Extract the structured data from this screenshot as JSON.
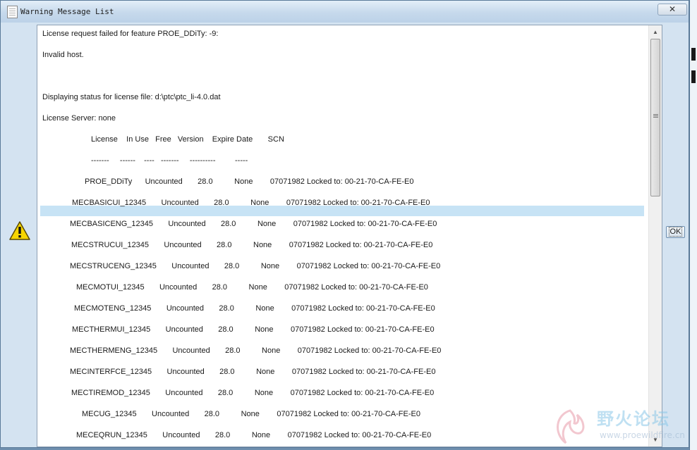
{
  "window": {
    "title": "Warning Message List",
    "close_label": "✕"
  },
  "messages": {
    "lines": [
      "License request failed for feature PROE_DDiTy: -9:",
      "Invalid host.",
      "Displaying status for license file: d:\\ptc\\ptc_li-4.0.dat",
      "License Server: none",
      "License    In Use   Free   Version    Expire Date       SCN",
      "-------     ------    ----   -------     ----------         -----"
    ],
    "rows": [
      {
        "text": "PROE_DDiTy      Uncounted       28.0          None        07071982 Locked to: 00-21-70-CA-FE-E0"
      },
      {
        "text": "MECBASICUI_12345       Uncounted       28.0          None        07071982 Locked to: 00-21-70-CA-FE-E0"
      },
      {
        "text": "MECBASICENG_12345       Uncounted       28.0          None        07071982 Locked to: 00-21-70-CA-FE-E0"
      },
      {
        "text": "MECSTRUCUI_12345       Uncounted       28.0          None        07071982 Locked to: 00-21-70-CA-FE-E0"
      },
      {
        "text": "MECSTRUCENG_12345       Uncounted       28.0          None        07071982 Locked to: 00-21-70-CA-FE-E0"
      },
      {
        "text": "MECMOTUI_12345       Uncounted       28.0          None        07071982 Locked to: 00-21-70-CA-FE-E0"
      },
      {
        "text": "MECMOTENG_12345       Uncounted       28.0          None        07071982 Locked to: 00-21-70-CA-FE-E0"
      },
      {
        "text": "MECTHERMUI_12345       Uncounted       28.0          None        07071982 Locked to: 00-21-70-CA-FE-E0"
      },
      {
        "text": "MECTHERMENG_12345       Uncounted       28.0          None        07071982 Locked to: 00-21-70-CA-FE-E0"
      },
      {
        "text": "MECINTERFCE_12345       Uncounted       28.0          None        07071982 Locked to: 00-21-70-CA-FE-E0"
      },
      {
        "text": "MECTIREMOD_12345       Uncounted       28.0          None        07071982 Locked to: 00-21-70-CA-FE-E0"
      },
      {
        "text": "MECUG_12345       Uncounted       28.0          None        07071982 Locked to: 00-21-70-CA-FE-E0"
      },
      {
        "text": "MECEQRUN_12345       Uncounted       28.0          None        07071982 Locked to: 00-21-70-CA-FE-E0"
      }
    ]
  },
  "buttons": {
    "ok_label": "OK"
  },
  "icons": {
    "warning": "warning-icon",
    "scroll_up": "▲",
    "scroll_down": "▼"
  },
  "watermark": {
    "text": "野火论坛",
    "url": "www.proewildfire.cn"
  }
}
